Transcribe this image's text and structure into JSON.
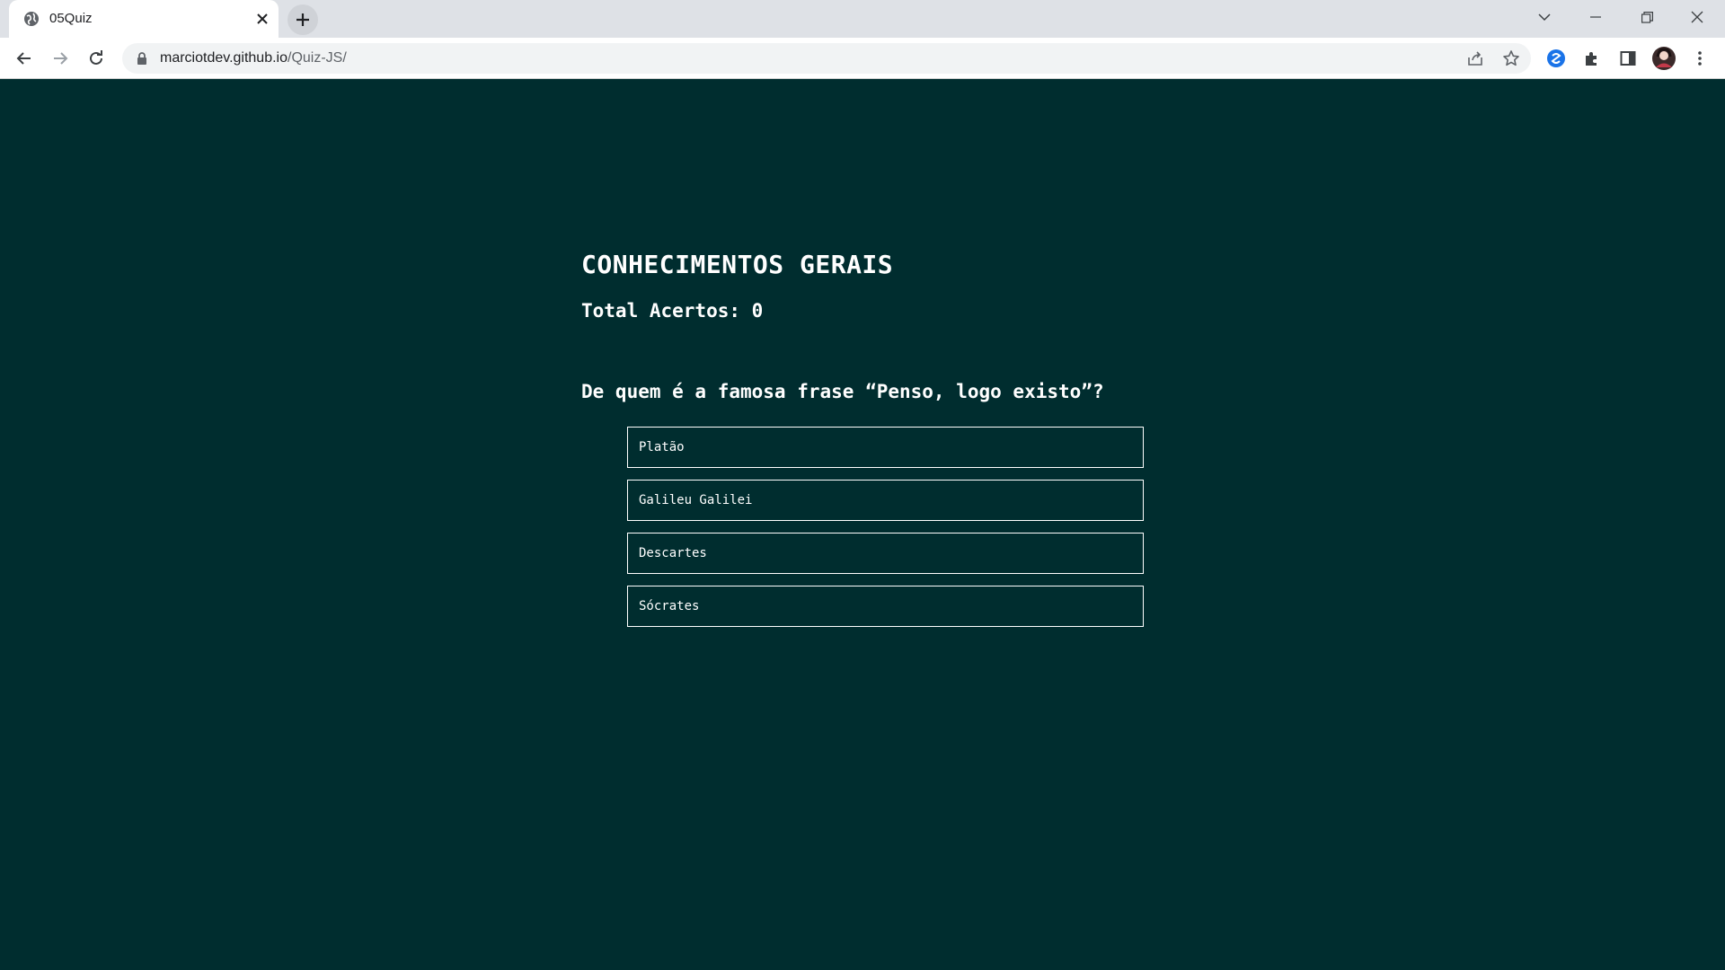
{
  "browser": {
    "tab_title": "05Quiz",
    "url_host": "marciotdev.github.io",
    "url_path": "/Quiz-JS/"
  },
  "quiz": {
    "title": "CONHECIMENTOS GERAIS",
    "score_text": "Total Acertos: 0",
    "question": "De quem é a famosa frase “Penso, logo existo”?",
    "answers": [
      "Platão",
      "Galileu Galilei",
      "Descartes",
      "Sócrates"
    ]
  },
  "colors": {
    "page_background": "#002d2f",
    "text": "#ffffff",
    "browser_frame": "#dee1e6"
  }
}
